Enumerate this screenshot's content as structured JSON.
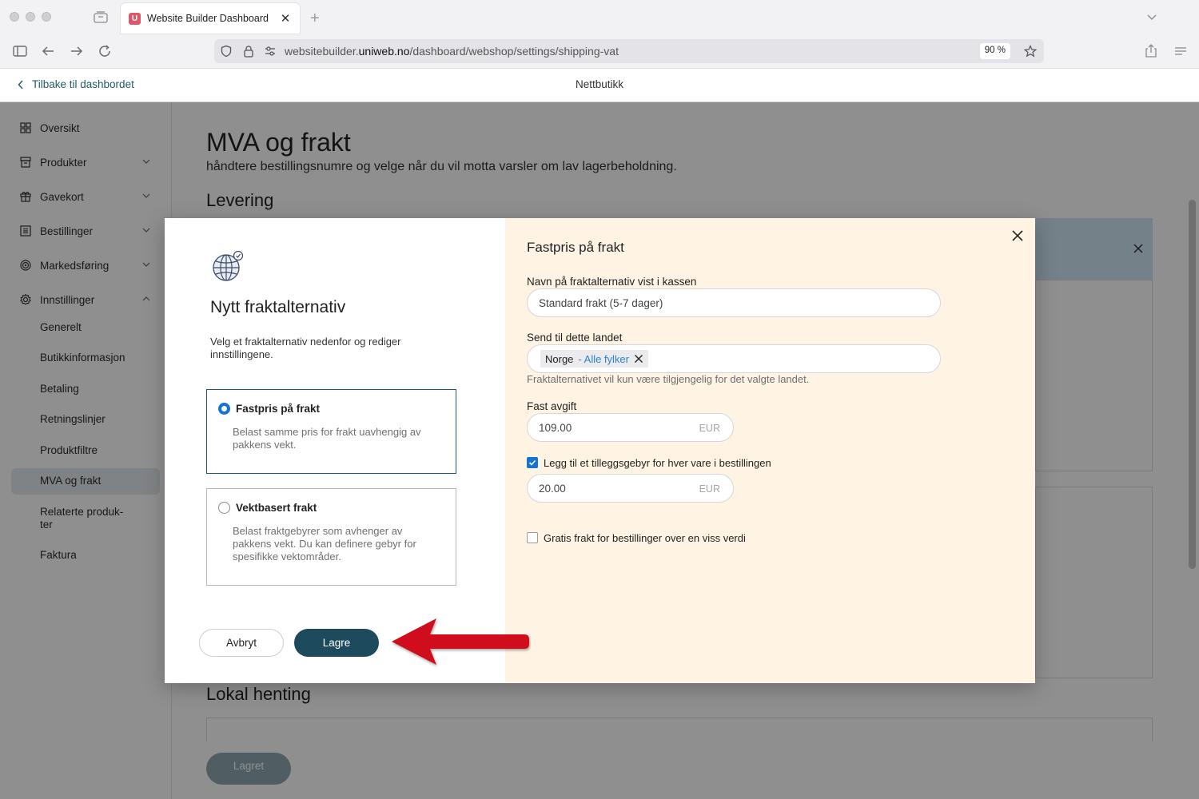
{
  "browser": {
    "tab_title": "Website Builder Dashboard",
    "tab_favicon": "U",
    "url_prefix": "websitebuilder.",
    "url_domain": "uniweb.no",
    "url_path": "/dashboard/webshop/settings/shipping-vat",
    "zoom": "90 %"
  },
  "header": {
    "back_label": "Tilbake til dashbordet",
    "title": "Nettbutikk"
  },
  "sidebar": {
    "items": [
      {
        "label": "Oversikt",
        "icon": "grid-icon"
      },
      {
        "label": "Produkter",
        "icon": "box-icon"
      },
      {
        "label": "Gavekort",
        "icon": "gift-icon"
      },
      {
        "label": "Bestillinger",
        "icon": "list-icon"
      },
      {
        "label": "Markedsføring",
        "icon": "target-icon"
      },
      {
        "label": "Innstillinger",
        "icon": "gear-icon"
      }
    ],
    "sub_items": [
      "Generelt",
      "Butikkinformasjon",
      "Betaling",
      "Retningslinjer",
      "Produktfiltre",
      "MVA og frakt",
      "Relaterte produk-ter",
      "Faktura"
    ]
  },
  "main": {
    "title": "MVA og frakt",
    "subtitle": "håndtere bestillingsnumre og velge når du vil motta varsler om lav lagerbeholdning.",
    "section_delivery": "Levering",
    "section_pickup": "Lokal henting",
    "saved_label": "Lagret"
  },
  "modal": {
    "title": "Nytt fraktalternativ",
    "description": "Velg et fraktalternativ nedenfor og rediger innstillingene.",
    "options": [
      {
        "title": "Fastpris på frakt",
        "description": "Belast samme pris for frakt uavhengig av pakkens vekt.",
        "selected": true
      },
      {
        "title": "Vektbasert frakt",
        "description": "Belast fraktgebyrer som avhenger av pakkens vekt. Du kan definere gebyr for spesifikke vektområder.",
        "selected": false
      }
    ],
    "cancel_label": "Avbryt",
    "save_label": "Lagre",
    "form": {
      "title": "Fastpris på frakt",
      "name_label": "Navn på fraktalternativ vist i kassen",
      "name_value": "Standard frakt (5-7 dager)",
      "country_label": "Send til dette landet",
      "country_value": "Norge",
      "country_region": "- Alle fylker",
      "country_hint": "Fraktalternativet vil kun være tilgjengelig for det valgte landet.",
      "fee_label": "Fast avgift",
      "fee_value": "109.00",
      "currency": "EUR",
      "extra_fee_checked": true,
      "extra_fee_label": "Legg til et tilleggsgebyr for hver vare i bestillingen",
      "extra_fee_value": "20.00",
      "free_shipping_checked": false,
      "free_shipping_label": "Gratis frakt for bestillinger over en viss verdi"
    }
  },
  "colors": {
    "accent": "#1d4a5c",
    "radio_blue": "#1474d6",
    "panel_bg": "#fff3e4",
    "arrow_red": "#d0101a"
  }
}
